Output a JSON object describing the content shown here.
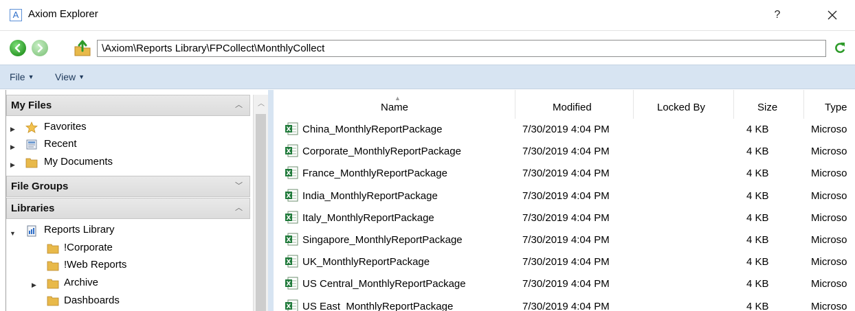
{
  "window": {
    "logo_letter": "A",
    "title": "Axiom Explorer",
    "help": "?",
    "close": "✕"
  },
  "address_bar": {
    "path": "\\Axiom\\Reports Library\\FPCollect\\MonthlyCollect"
  },
  "menu": {
    "file": "File",
    "view": "View"
  },
  "left_panel": {
    "my_files": {
      "header": "My Files",
      "items": [
        "Favorites",
        "Recent",
        "My Documents"
      ]
    },
    "file_groups": {
      "header": "File Groups"
    },
    "libraries": {
      "header": "Libraries",
      "root": "Reports Library",
      "children": [
        "!Corporate",
        "!Web Reports",
        "Archive",
        "Dashboards"
      ]
    }
  },
  "file_list": {
    "columns": {
      "name": "Name",
      "modified": "Modified",
      "locked_by": "Locked By",
      "size": "Size",
      "type": "Type"
    },
    "rows": [
      {
        "name": "China_MonthlyReportPackage",
        "modified": "7/30/2019 4:04 PM",
        "locked_by": "",
        "size": "4 KB",
        "type": "Microso"
      },
      {
        "name": "Corporate_MonthlyReportPackage",
        "modified": "7/30/2019 4:04 PM",
        "locked_by": "",
        "size": "4 KB",
        "type": "Microso"
      },
      {
        "name": "France_MonthlyReportPackage",
        "modified": "7/30/2019 4:04 PM",
        "locked_by": "",
        "size": "4 KB",
        "type": "Microso"
      },
      {
        "name": "India_MonthlyReportPackage",
        "modified": "7/30/2019 4:04 PM",
        "locked_by": "",
        "size": "4 KB",
        "type": "Microso"
      },
      {
        "name": "Italy_MonthlyReportPackage",
        "modified": "7/30/2019 4:04 PM",
        "locked_by": "",
        "size": "4 KB",
        "type": "Microso"
      },
      {
        "name": "Singapore_MonthlyReportPackage",
        "modified": "7/30/2019 4:04 PM",
        "locked_by": "",
        "size": "4 KB",
        "type": "Microso"
      },
      {
        "name": "UK_MonthlyReportPackage",
        "modified": "7/30/2019 4:04 PM",
        "locked_by": "",
        "size": "4 KB",
        "type": "Microso"
      },
      {
        "name": "US Central_MonthlyReportPackage",
        "modified": "7/30/2019 4:04 PM",
        "locked_by": "",
        "size": "4 KB",
        "type": "Microso"
      },
      {
        "name": "US East_MonthlyReportPackage",
        "modified": "7/30/2019 4:04 PM",
        "locked_by": "",
        "size": "4 KB",
        "type": "Microso"
      }
    ]
  },
  "icons": {
    "back": "back-arrow-icon",
    "forward": "forward-arrow-icon",
    "up": "up-folder-icon",
    "refresh": "refresh-icon",
    "file": "excel-file-icon",
    "folder": "folder-icon",
    "star": "star-icon"
  },
  "colors": {
    "menubar": "#d7e4f2",
    "excel_green": "#1f7a3a",
    "folder_yellow": "#e8b94a"
  }
}
